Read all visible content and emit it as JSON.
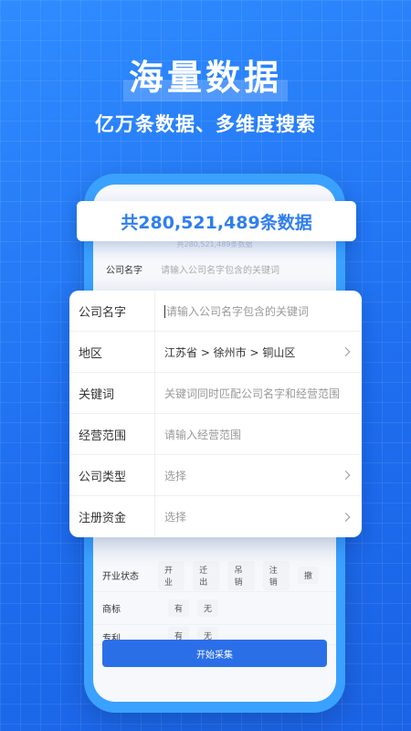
{
  "hero": {
    "title": "海量数据",
    "subtitle": "亿万条数据、多维度搜索"
  },
  "banner": {
    "count_text": "共280,521,489条数据"
  },
  "background_form": {
    "faint_count": "共280,521,489条数据",
    "company_name_label": "公司名字",
    "company_name_placeholder": "请输入公司名字包含的关键词"
  },
  "filter_card": {
    "rows": [
      {
        "label": "公司名字",
        "value": "请输入公司名字包含的关键词",
        "placeholder": true,
        "chevron": false
      },
      {
        "label": "地区",
        "value": "江苏省 > 徐州市 > 铜山区",
        "placeholder": false,
        "chevron": true
      },
      {
        "label": "关键词",
        "value": "关键词同时匹配公司名字和经营范围",
        "placeholder": true,
        "chevron": false
      },
      {
        "label": "经营范围",
        "value": "请输入经营范围",
        "placeholder": true,
        "chevron": false
      },
      {
        "label": "公司类型",
        "value": "选择",
        "placeholder": true,
        "chevron": true
      },
      {
        "label": "注册资金",
        "value": "选择",
        "placeholder": true,
        "chevron": true
      }
    ]
  },
  "lower_form": {
    "business_status": {
      "label": "开业状态",
      "options": [
        "开业",
        "迁出",
        "吊销",
        "注销",
        "撤"
      ]
    },
    "trademark": {
      "label": "商标",
      "options": [
        "有",
        "无"
      ]
    },
    "patent": {
      "label": "专利",
      "options": [
        "有",
        "无"
      ]
    }
  },
  "actions": {
    "start_label": "开始采集"
  },
  "colors": {
    "primary": "#2b6fe8",
    "background": "#1f6ff0",
    "phone_frame": "#3aa1ff"
  }
}
